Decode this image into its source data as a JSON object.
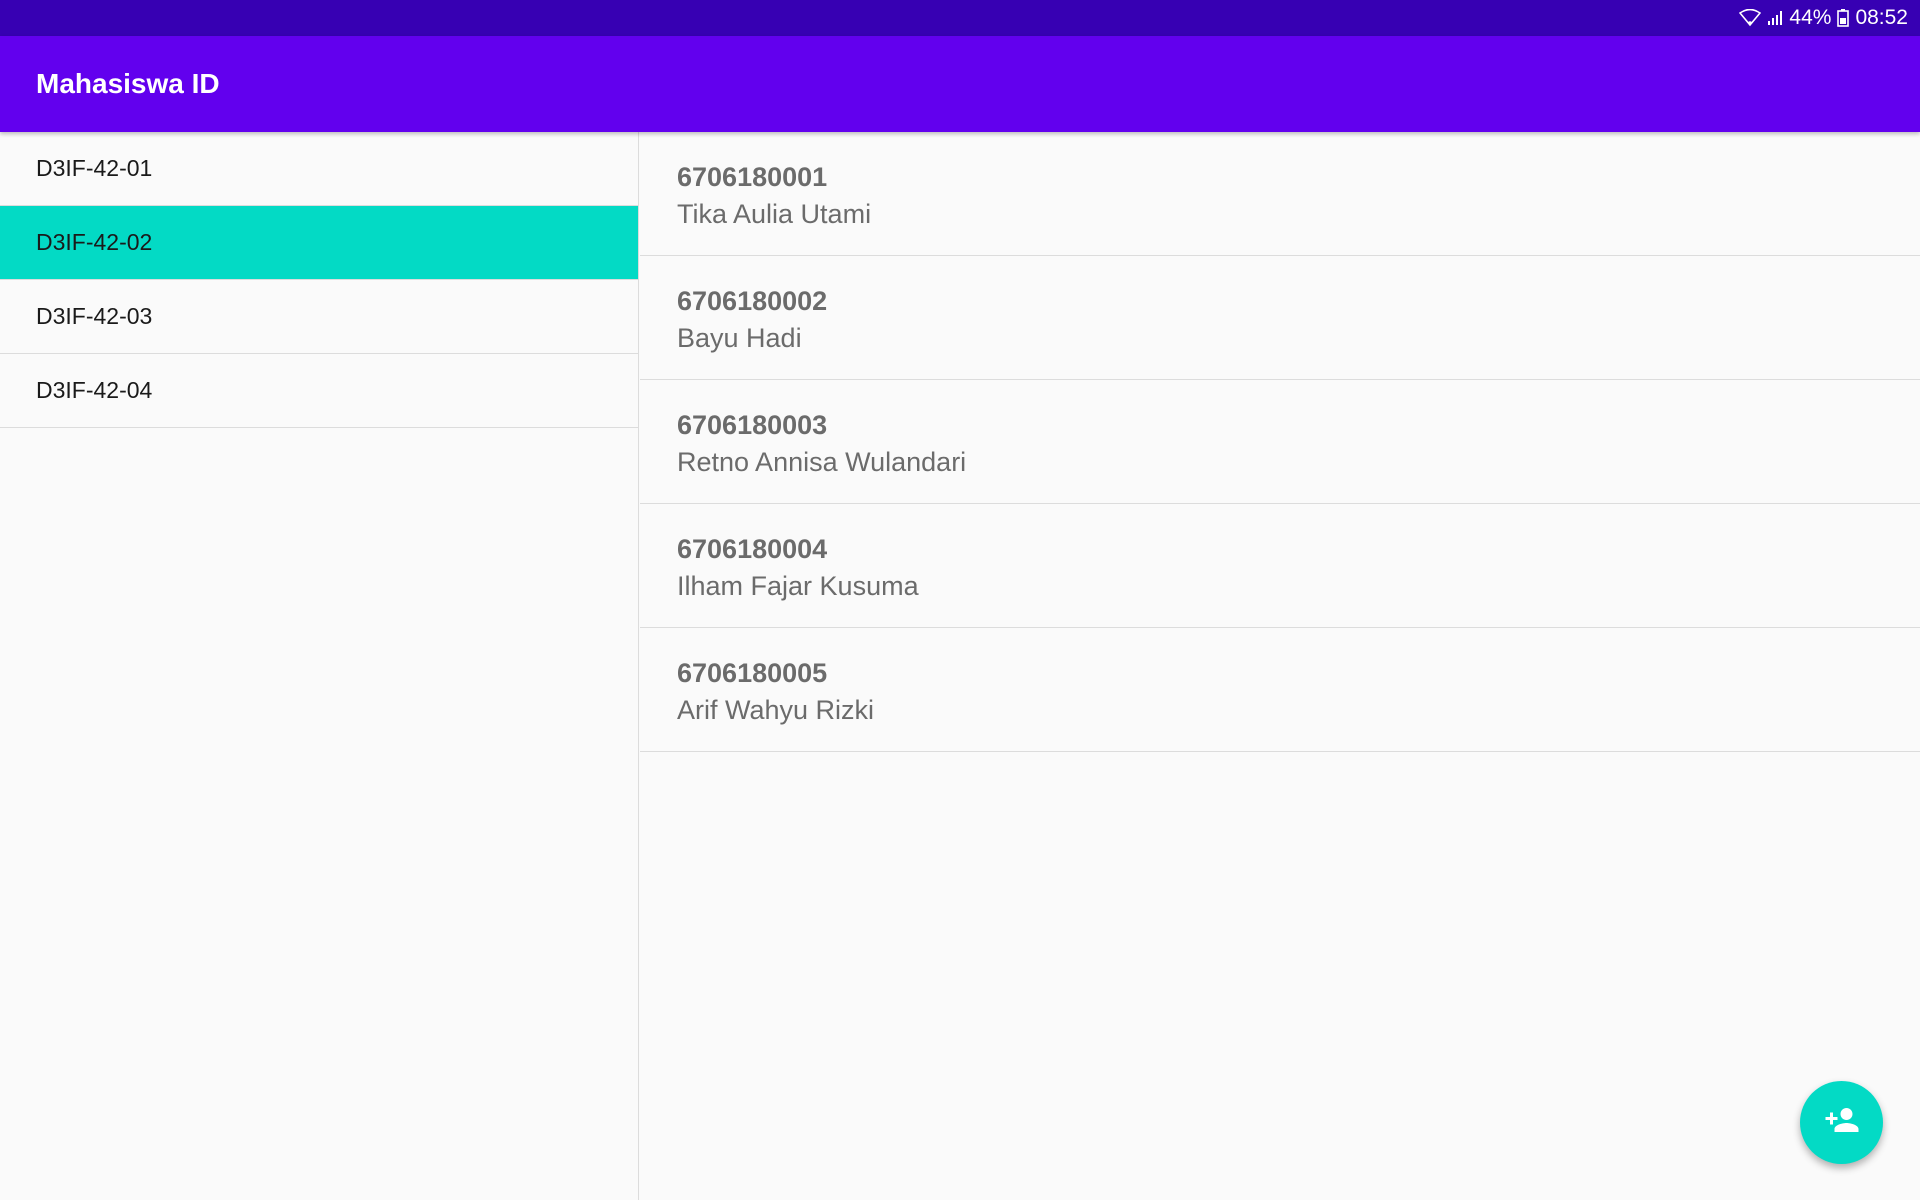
{
  "status_bar": {
    "battery": "44%",
    "time": "08:52",
    "icons": [
      "wifi-icon",
      "signal-icon",
      "battery-icon"
    ]
  },
  "app_bar": {
    "title": "Mahasiswa ID"
  },
  "classes": {
    "items": [
      {
        "label": "D3IF-42-01"
      },
      {
        "label": "D3IF-42-02"
      },
      {
        "label": "D3IF-42-03"
      },
      {
        "label": "D3IF-42-04"
      }
    ],
    "selected": "D3IF-42-02"
  },
  "students": {
    "items": [
      {
        "nim": "6706180001",
        "name": "Tika Aulia Utami"
      },
      {
        "nim": "6706180002",
        "name": "Bayu Hadi"
      },
      {
        "nim": "6706180003",
        "name": "Retno Annisa Wulandari"
      },
      {
        "nim": "6706180004",
        "name": "Ilham Fajar Kusuma"
      },
      {
        "nim": "6706180005",
        "name": "Arif Wahyu Rizki"
      }
    ]
  },
  "fab": {
    "icon": "add-person-icon"
  },
  "colors": {
    "status_bar": "#3700b3",
    "primary": "#6200ee",
    "accent": "#03dac5",
    "text_secondary": "#6b6b6b"
  }
}
